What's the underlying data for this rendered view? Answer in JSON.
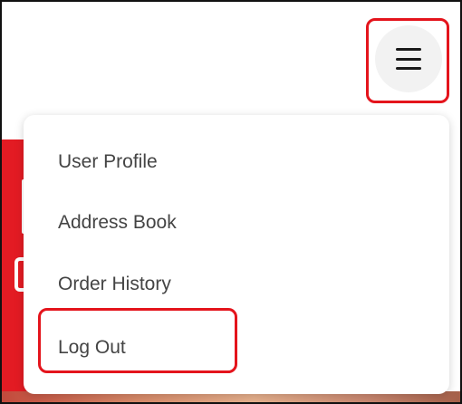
{
  "menu_button": {
    "icon": "hamburger-menu-icon"
  },
  "dropdown": {
    "items": [
      {
        "label": "User Profile"
      },
      {
        "label": "Address Book"
      },
      {
        "label": "Order History"
      },
      {
        "label": "Log Out"
      }
    ]
  },
  "colors": {
    "highlight": "#e4141c",
    "brand_red": "#e31b23",
    "menu_button_bg": "#f2f2f2"
  }
}
